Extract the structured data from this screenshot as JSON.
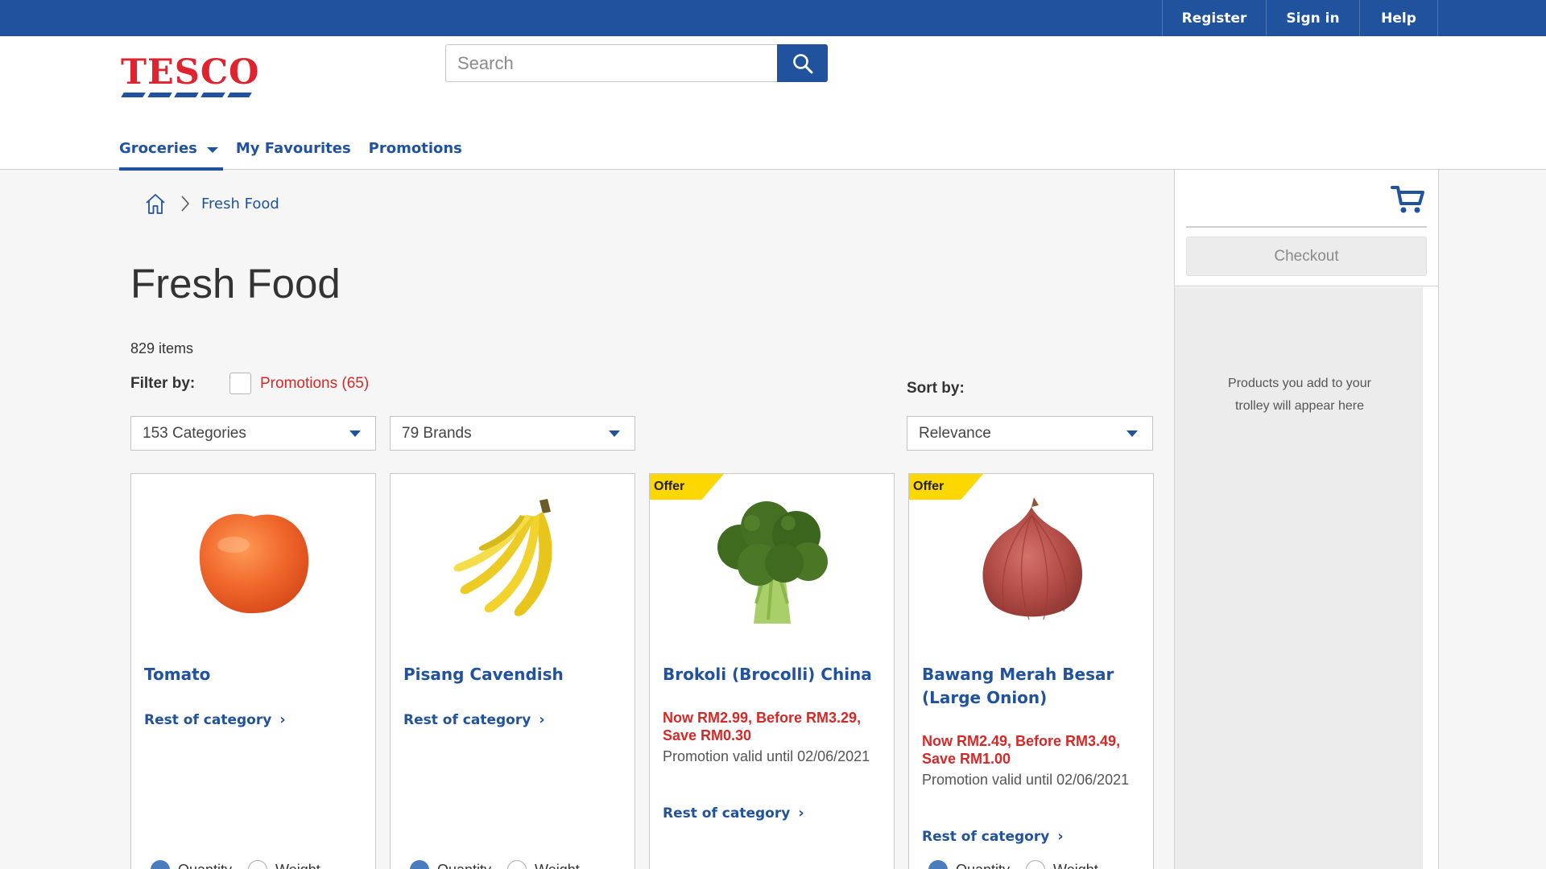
{
  "topbar": {
    "links": [
      "Register",
      "Sign in",
      "Help"
    ]
  },
  "header": {
    "logo_text": "TESCO",
    "search_placeholder": "Search",
    "nav": [
      {
        "label": "Groceries",
        "active": true,
        "has_dropdown": true
      },
      {
        "label": "My Favourites"
      },
      {
        "label": "Promotions"
      }
    ]
  },
  "breadcrumb": {
    "items": [
      "Fresh Food"
    ]
  },
  "main": {
    "title": "Fresh Food",
    "item_count": "829 items",
    "filter_label": "Filter by:",
    "promo_filter": "Promotions (65)",
    "sort_label": "Sort by:",
    "categories_select": "153 Categories",
    "brands_select": "79 Brands",
    "sort_select": "Relevance"
  },
  "products": [
    {
      "name": "Tomato",
      "offer": false,
      "rest_link": "Rest of category",
      "image_icon": "tomato-icon"
    },
    {
      "name": "Pisang Cavendish",
      "offer": false,
      "rest_link": "Rest of category",
      "image_icon": "banana-icon"
    },
    {
      "name": "Brokoli (Brocolli) China",
      "offer": true,
      "offer_label": "Offer",
      "promo": "Now RM2.99, Before RM3.29, Save RM0.30",
      "valid": "Promotion valid until 02/06/2021",
      "rest_link": "Rest of category",
      "image_icon": "broccoli-icon"
    },
    {
      "name": "Bawang Merah Besar (Large Onion)",
      "offer": true,
      "offer_label": "Offer",
      "promo": "Now RM2.49, Before RM3.49, Save RM1.00",
      "valid": "Promotion valid until 02/06/2021",
      "rest_link": "Rest of category",
      "image_icon": "onion-icon"
    }
  ],
  "quantity_label": "Quantity",
  "weight_label": "Weight",
  "trolley": {
    "checkout_label": "Checkout",
    "empty_message": "Products you add to your trolley will appear here"
  },
  "colors": {
    "brand_blue": "#21529d",
    "brand_red": "#e0242f",
    "promo_red": "#d62827",
    "offer_yellow": "#fcd700"
  }
}
